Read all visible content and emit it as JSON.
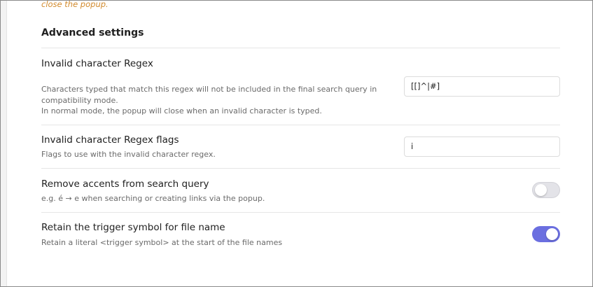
{
  "previous_setting": {
    "description_tail": "close the popup."
  },
  "section": {
    "title": "Advanced settings"
  },
  "settings": [
    {
      "name": "Invalid character Regex",
      "description_lines": [
        "Characters typed that match this regex will not be included in the final search query in",
        "compatibility mode.",
        "In normal mode, the popup will close when an invalid character is typed."
      ],
      "control": "text",
      "value": "[[]^|#]"
    },
    {
      "name": "Invalid character Regex flags",
      "description_lines": [
        "Flags to use with the invalid character regex."
      ],
      "control": "text",
      "value": "i"
    },
    {
      "name": "Remove accents from search query",
      "description_lines": [
        "e.g. é → e when searching or creating links via the popup."
      ],
      "control": "toggle",
      "enabled": false
    },
    {
      "name": "Retain the trigger symbol for file name",
      "description_lines": [
        "Retain a literal <trigger symbol> at the start of the file names"
      ],
      "control": "toggle",
      "enabled": true
    }
  ],
  "colors": {
    "accent": "#6b6fe0",
    "warning_text": "#d28a2c"
  }
}
